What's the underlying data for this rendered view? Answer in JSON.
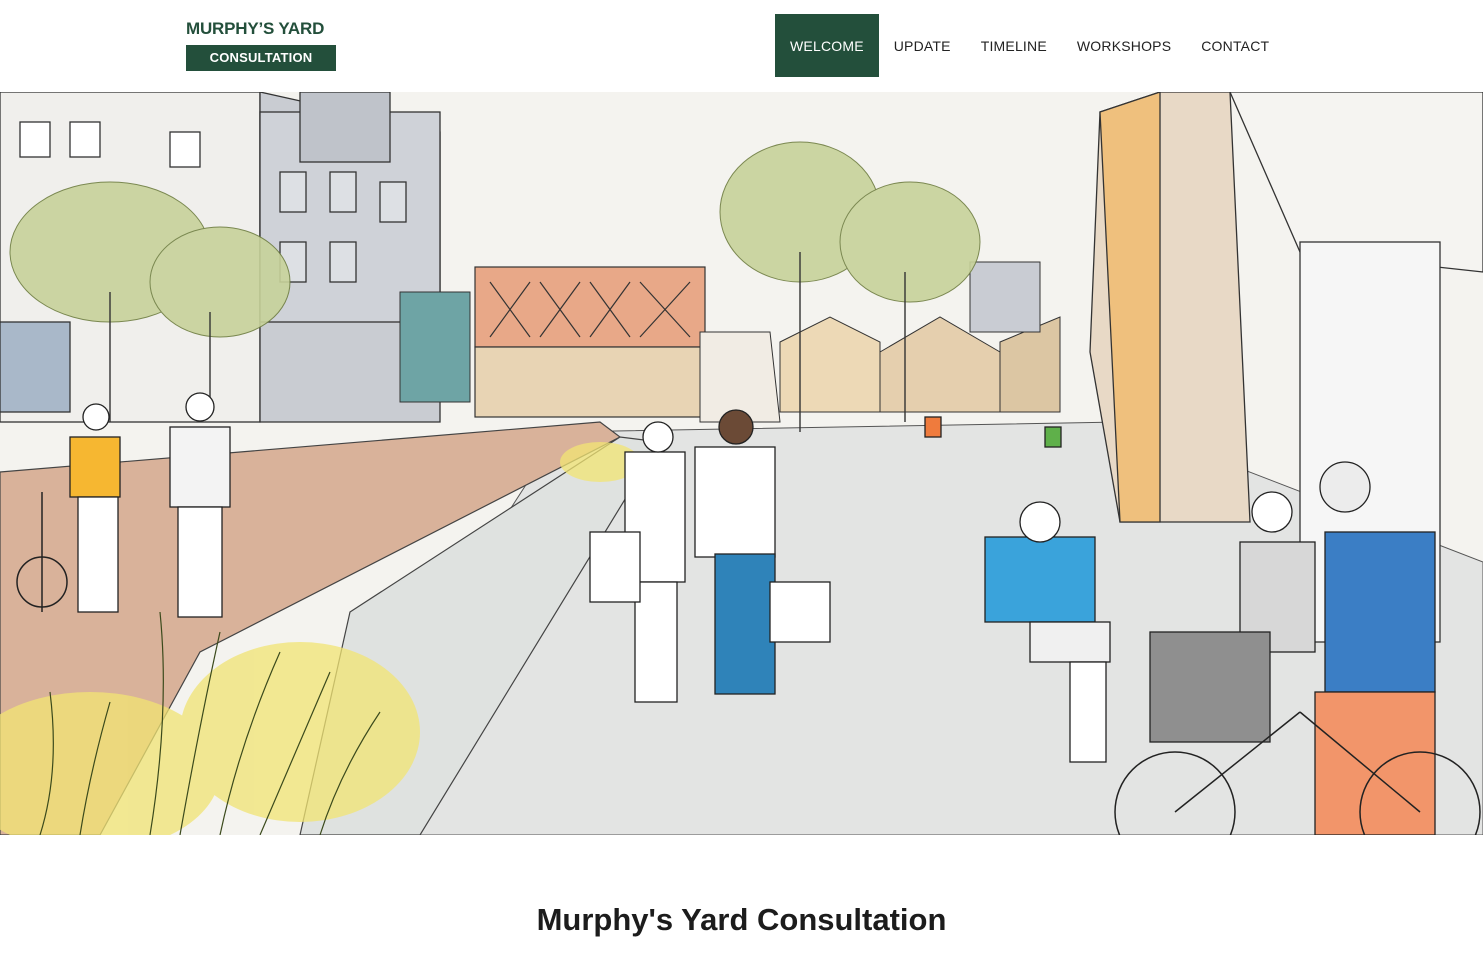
{
  "logo": {
    "title": "MURPHY’S YARD",
    "subtitle": "CONSULTATION"
  },
  "nav": {
    "items": [
      {
        "label": "WELCOME",
        "active": true
      },
      {
        "label": "UPDATE",
        "active": false
      },
      {
        "label": "TIMELINE",
        "active": false
      },
      {
        "label": "WORKSHOPS",
        "active": false
      },
      {
        "label": "CONTACT",
        "active": false
      }
    ]
  },
  "hero": {
    "image": "street-scene-sketch-illustration"
  },
  "main": {
    "title": "Murphy's Yard Consultation"
  },
  "colors": {
    "brand_green": "#234f3b",
    "background": "#ffffff"
  }
}
